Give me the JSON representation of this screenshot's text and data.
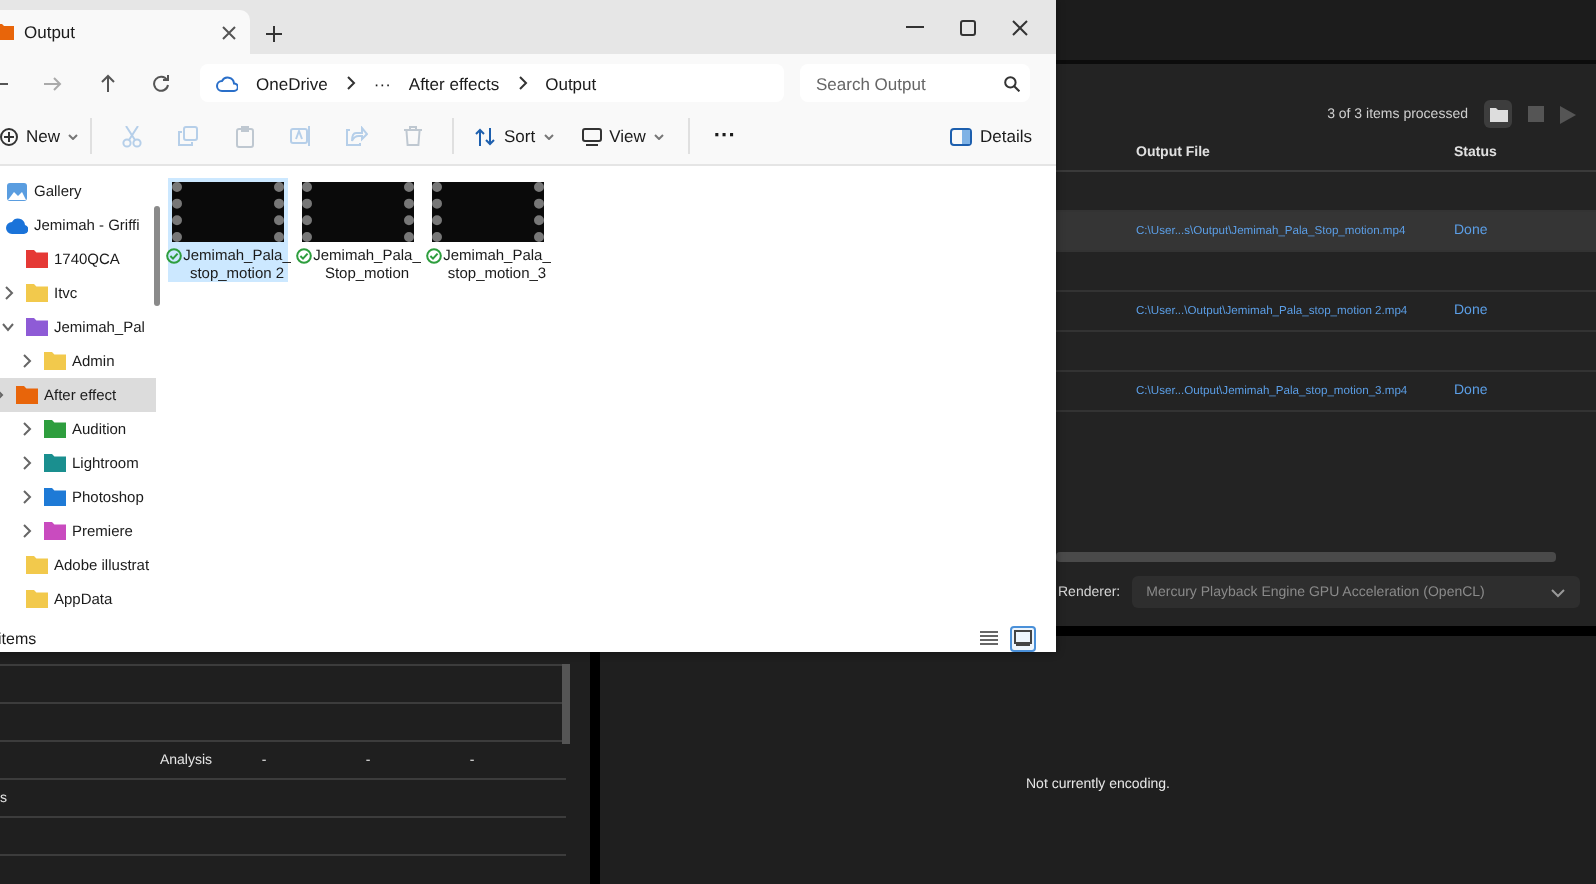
{
  "explorer": {
    "tab": {
      "title": "Output"
    },
    "address": {
      "root": "OneDrive",
      "overflow": "···",
      "segments": [
        "After effects",
        "Output"
      ]
    },
    "search": {
      "placeholder": "Search Output"
    },
    "toolbar": {
      "new": "New",
      "actions": [
        {
          "kind": "cut",
          "disabled": true
        },
        {
          "kind": "copy",
          "disabled": true
        },
        {
          "kind": "paste",
          "disabled": true
        },
        {
          "kind": "rename",
          "disabled": true
        },
        {
          "kind": "share",
          "disabled": true
        },
        {
          "kind": "delete",
          "disabled": true
        }
      ],
      "sort": "Sort",
      "view": "View",
      "more": "···",
      "details": "Details"
    },
    "sidebar": [
      {
        "kind": "gallery",
        "label": "Gallery",
        "selected": false
      },
      {
        "kind": "cloud",
        "label": "Jemimah - Griffi",
        "selected": false,
        "children": [
          {
            "kind": "folder",
            "label": "1740QCA",
            "color": "#e53935",
            "selected": false
          },
          {
            "kind": "folder",
            "label": "Itvc",
            "color": "#f2c94c",
            "selected": false,
            "expanded": false
          },
          {
            "kind": "folder",
            "label": "Jemimah_Pal",
            "color": "#8e5bd6",
            "selected": false,
            "expanded": true,
            "children": [
              {
                "kind": "folder",
                "label": "Admin",
                "color": "#f2c94c",
                "selected": false,
                "expanded": false
              },
              {
                "kind": "folder",
                "label": "After effect",
                "color": "#e8650a",
                "selected": true,
                "expanded": false
              },
              {
                "kind": "folder",
                "label": "Audition",
                "color": "#2e9e3e",
                "selected": false,
                "expanded": false
              },
              {
                "kind": "folder",
                "label": "Lightroom",
                "color": "#1a8f8f",
                "selected": false,
                "expanded": false
              },
              {
                "kind": "folder",
                "label": "Photoshop",
                "color": "#1e7ad6",
                "selected": false,
                "expanded": false
              },
              {
                "kind": "folder",
                "label": "Premiere",
                "color": "#c94bbf",
                "selected": false,
                "expanded": false
              }
            ]
          },
          {
            "kind": "folder",
            "label": "Adobe illustrat",
            "color": "#f2c94c",
            "selected": false
          },
          {
            "kind": "folder",
            "label": "AppData",
            "color": "#f2c94c",
            "selected": false
          }
        ]
      }
    ],
    "files": [
      {
        "lines": [
          "Jemimah_Pala_",
          "stop_motion 2"
        ],
        "synced": true,
        "selected": true
      },
      {
        "lines": [
          "Jemimah_Pala_",
          "Stop_motion"
        ],
        "synced": true,
        "selected": false
      },
      {
        "lines": [
          "Jemimah_Pala_",
          "stop_motion_3"
        ],
        "synced": true,
        "selected": false
      }
    ],
    "status": "items",
    "view_modes": [
      {
        "kind": "details",
        "selected": false
      },
      {
        "kind": "tiles",
        "selected": true
      }
    ]
  },
  "encoder": {
    "queue": {
      "summary": "3 of 3 items processed",
      "columns": [
        "Output File",
        "Status"
      ],
      "rows": [
        {
          "output_file": "C:\\User...s\\Output\\Jemimah_Pala_Stop_motion.mp4",
          "status": "Done",
          "selected": true
        },
        {
          "output_file": "C:\\User...\\Output\\Jemimah_Pala_stop_motion 2.mp4",
          "status": "Done",
          "selected": false
        },
        {
          "output_file": "C:\\User...Output\\Jemimah_Pala_stop_motion_3.mp4",
          "status": "Done",
          "selected": false
        }
      ]
    },
    "renderer": {
      "label": "Renderer:",
      "value": "Mercury Playback Engine GPU Acceleration (OpenCL)"
    },
    "encoding": {
      "rows": [
        {
          "column_2": "Analysis",
          "column_3": "-",
          "column_4": "-",
          "column_5": "-"
        },
        {
          "column_1": "s"
        }
      ],
      "message": "Not currently encoding."
    }
  }
}
